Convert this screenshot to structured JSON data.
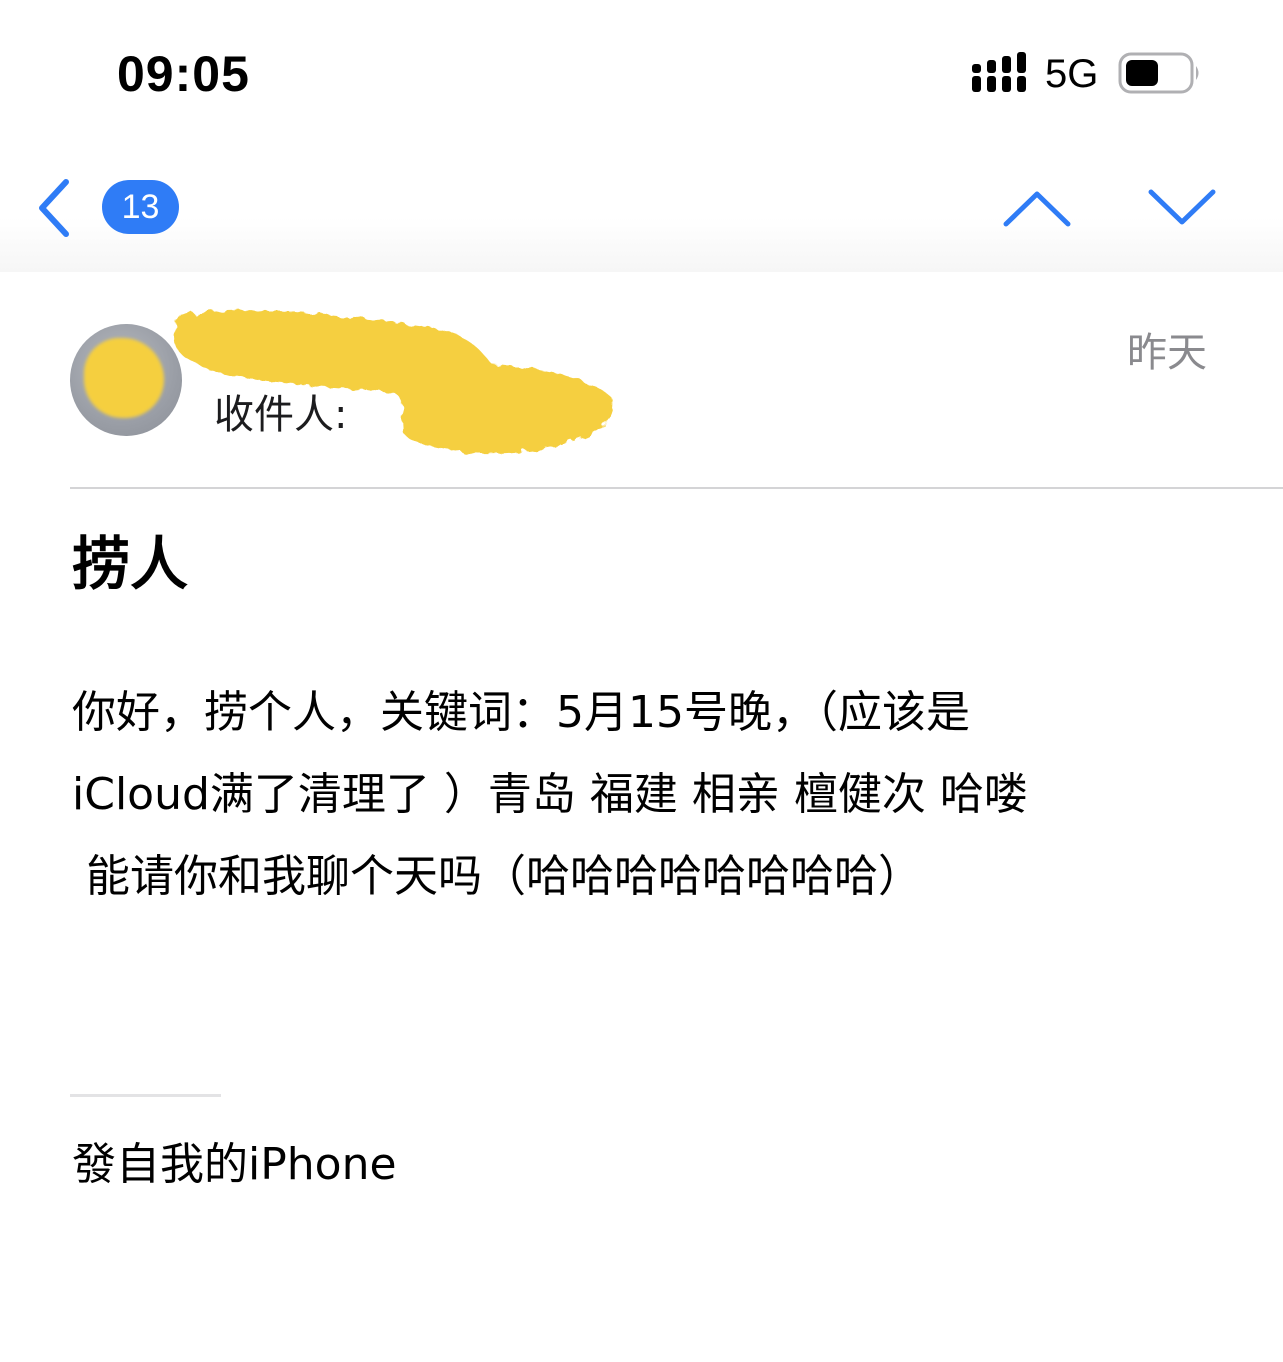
{
  "status_bar": {
    "time": "09:05",
    "network": "5G",
    "icons": [
      "signal-bars-icon",
      "battery-icon"
    ]
  },
  "nav": {
    "back_icon": "chevron-left-icon",
    "unread_count": "13",
    "prev_icon": "chevron-up-icon",
    "next_icon": "chevron-down-icon",
    "accent_color": "#2f7cf6"
  },
  "header": {
    "recipient_label": "收件人:",
    "date": "昨天",
    "redaction_color": "#f5cf3f"
  },
  "message": {
    "subject": "捞人",
    "body_lines": [
      "你好，捞个人，关键词：5月15号晚，（应该是",
      "iCloud满了清理了 ）青岛 福建 相亲 檀健次 哈喽",
      " 能请你和我聊个天吗（哈哈哈哈哈哈哈哈）"
    ],
    "signature": "發自我的iPhone"
  }
}
